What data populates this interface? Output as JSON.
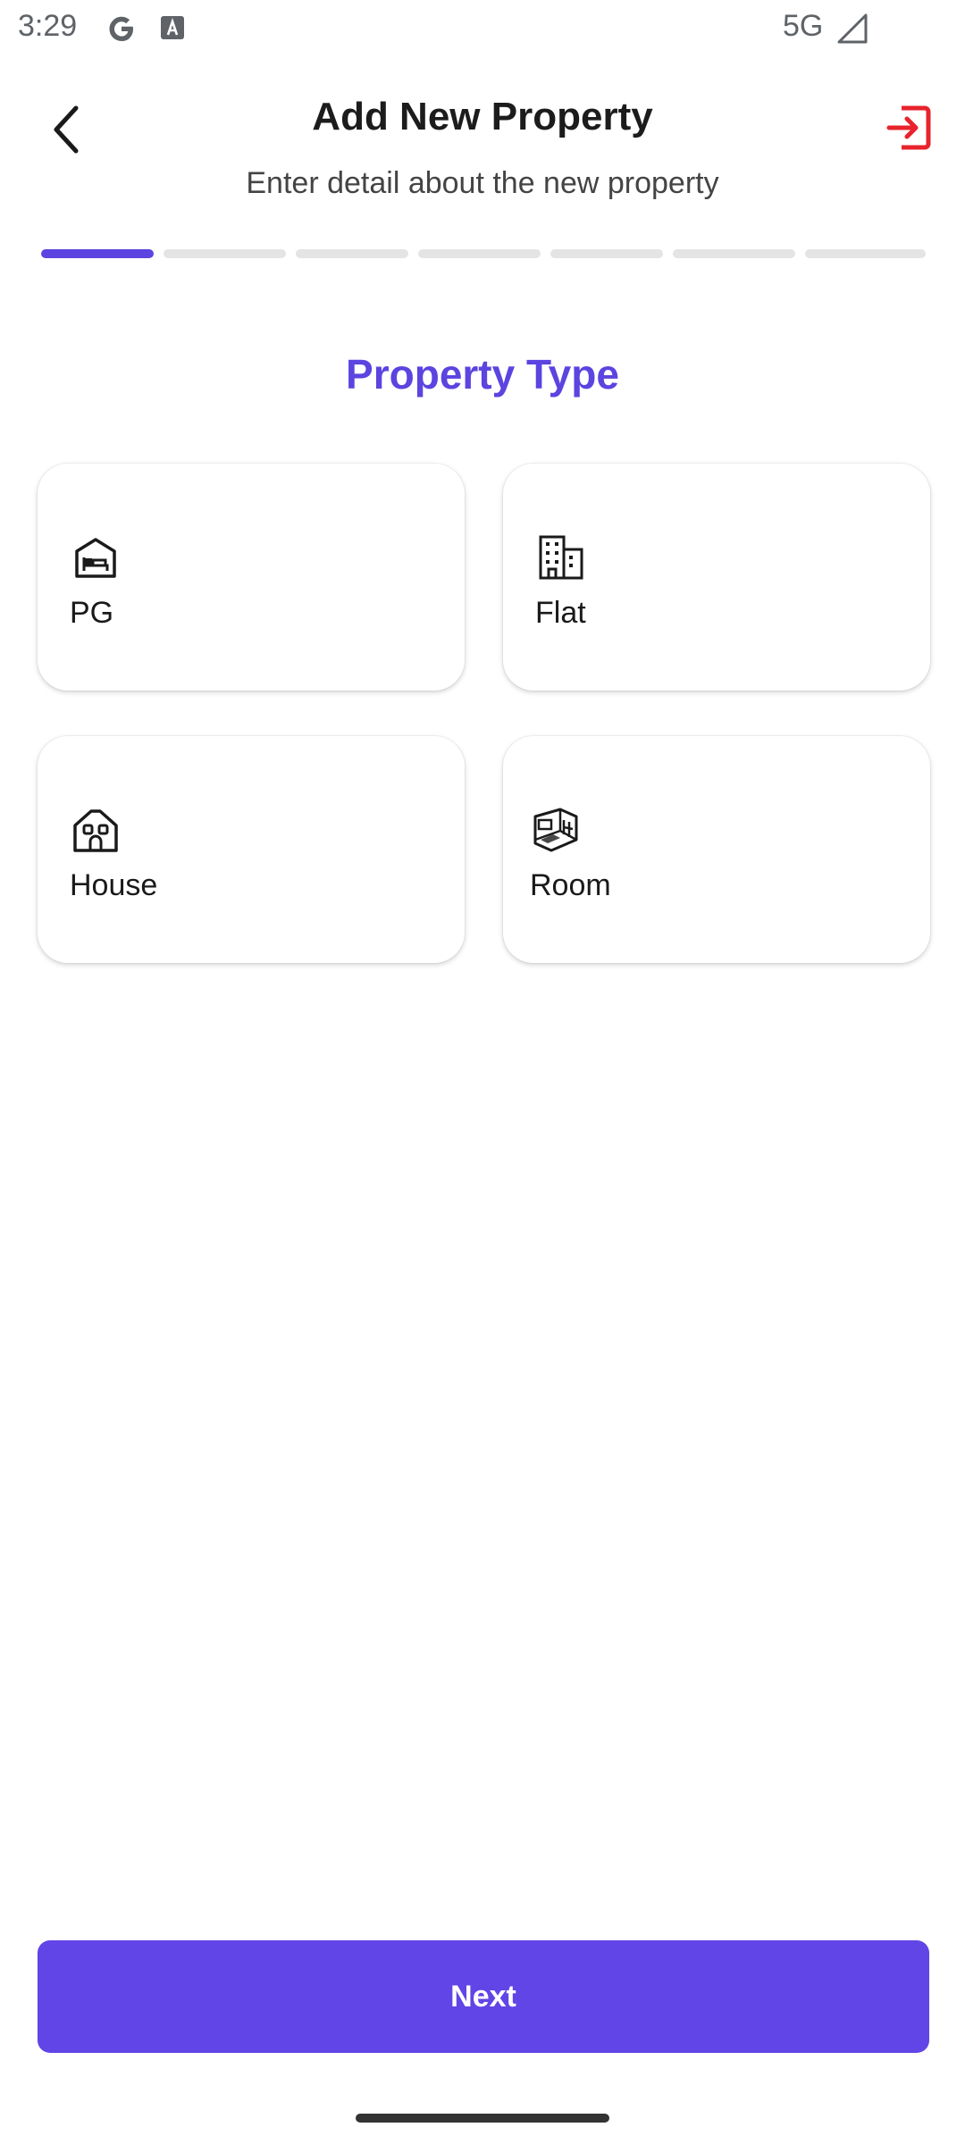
{
  "status_bar": {
    "time": "3:29",
    "network": "5G",
    "icons": [
      "google-g-icon",
      "text-a-icon",
      "cellular-signal-icon"
    ]
  },
  "header": {
    "title": "Add New Property",
    "subtitle": "Enter detail about the new property",
    "back_icon": "chevron-left-icon",
    "exit_icon": "exit-icon",
    "exit_color": "#e8232b"
  },
  "progress": {
    "total_steps": 7,
    "current_step": 1,
    "active_color": "#5b44e0",
    "inactive_color": "#e4e4e4"
  },
  "section": {
    "title": "Property Type",
    "title_color": "#5b44e0"
  },
  "property_types": [
    {
      "label": "PG",
      "icon": "pg-hostel-icon"
    },
    {
      "label": "Flat",
      "icon": "building-icon"
    },
    {
      "label": "House",
      "icon": "house-icon"
    },
    {
      "label": "Room",
      "icon": "room-icon"
    }
  ],
  "footer": {
    "next_label": "Next",
    "button_color": "#6145e6"
  }
}
